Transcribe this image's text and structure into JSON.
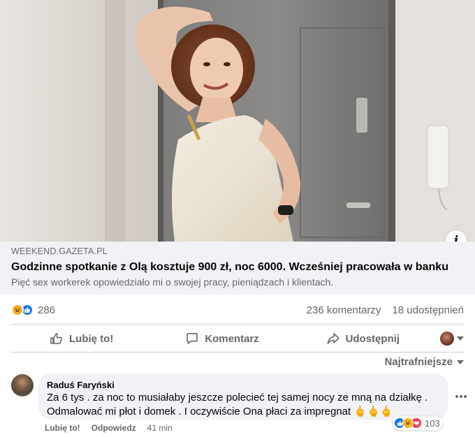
{
  "post": {
    "link_domain": "WEEKEND.GAZETA.PL",
    "link_title": "Godzinne spotkanie z Olą kosztuje 900 zł, noc 6000. Wcześniej pracowała w banku",
    "link_description": "Pięć sex workerek opowiedziało mi o swojej pracy, pieniądzach i klientach.",
    "info_glyph": "i",
    "reactions": {
      "icons": [
        "haha-reaction-icon",
        "like-reaction-icon"
      ],
      "count": "286"
    },
    "comments_count": "236 komentarzy",
    "shares_count": "18 udostępnień"
  },
  "actions": {
    "like_label": "Lubię to!",
    "comment_label": "Komentarz",
    "share_label": "Udostępnij"
  },
  "comments_sort": "Najtrafniejsze",
  "comment": {
    "author": "Raduś Faryński",
    "line1": "Za 6 tys . za noc to musiałaby jeszcze polecieć tej samej nocy ze mną na działkę .",
    "line2": "Odmalować mi płot i domek . I oczywiście Ona płaci za impregnat 🖕🖕🖕",
    "reactions_count": "103",
    "like_label": "Lubię to!",
    "reply_label": "Odpowiedz",
    "time": "41 min"
  },
  "colors": {
    "link_bg": "#f0f2f5",
    "secondary_text": "#65676b",
    "like_blue": "#1877f2",
    "haha_yellow": "#f7b125",
    "love_red": "#f33e58"
  }
}
